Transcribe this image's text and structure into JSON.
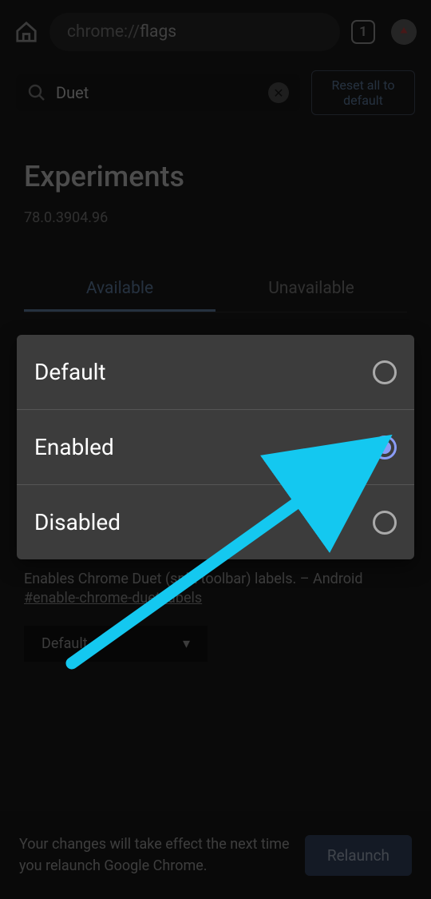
{
  "toolbar": {
    "url_prefix": "chrome://",
    "url_path": "flags",
    "tab_count": "1"
  },
  "search": {
    "value": "Duet",
    "reset_label": "Reset all to default"
  },
  "page": {
    "title": "Experiments",
    "version": "78.0.3904.96"
  },
  "tabs": {
    "available": "Available",
    "unavailable": "Unavailable"
  },
  "flag": {
    "description": "Enables Chrome Duet (split toolbar) labels. – Android",
    "hash": "#enable-chrome-duet-labels",
    "select_value": "Default"
  },
  "bottom": {
    "text": "Your changes will take effect the next time you relaunch Google Chrome.",
    "relaunch_label": "Relaunch"
  },
  "popup": {
    "options": [
      {
        "label": "Default",
        "selected": false
      },
      {
        "label": "Enabled",
        "selected": true
      },
      {
        "label": "Disabled",
        "selected": false
      }
    ]
  }
}
